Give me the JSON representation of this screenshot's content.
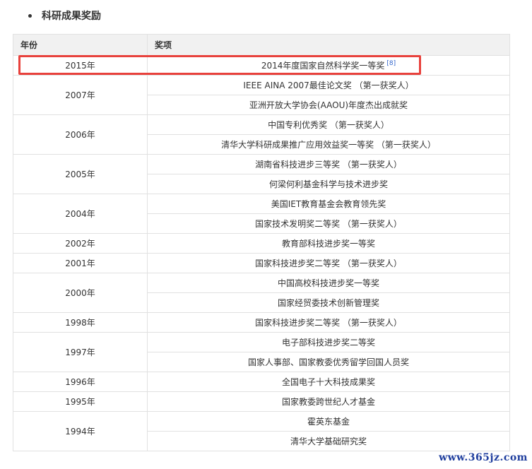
{
  "section": {
    "title": "科研成果奖励"
  },
  "table": {
    "headers": {
      "year": "年份",
      "award": "奖项"
    },
    "groups": [
      {
        "year": "2015年",
        "awards": [
          {
            "text": "2014年度国家自然科学奖一等奖",
            "ref": "[8]"
          }
        ]
      },
      {
        "year": "2007年",
        "awards": [
          {
            "text": "IEEE AINA 2007最佳论文奖 （第一获奖人）"
          },
          {
            "text": "亚洲开放大学协会(AAOU)年度杰出成就奖"
          }
        ]
      },
      {
        "year": "2006年",
        "awards": [
          {
            "text": "中国专利优秀奖 （第一获奖人）"
          },
          {
            "text": "清华大学科研成果推广应用效益奖一等奖 （第一获奖人）"
          }
        ]
      },
      {
        "year": "2005年",
        "awards": [
          {
            "text": "湖南省科技进步三等奖 （第一获奖人）"
          },
          {
            "text": "何梁何利基金科学与技术进步奖"
          }
        ]
      },
      {
        "year": "2004年",
        "awards": [
          {
            "text": "美国IET教育基金会教育领先奖"
          },
          {
            "text": "国家技术发明奖二等奖 （第一获奖人）"
          }
        ]
      },
      {
        "year": "2002年",
        "awards": [
          {
            "text": "教育部科技进步奖一等奖"
          }
        ]
      },
      {
        "year": "2001年",
        "awards": [
          {
            "text": "国家科技进步奖二等奖 （第一获奖人）"
          }
        ]
      },
      {
        "year": "2000年",
        "awards": [
          {
            "text": "中国高校科技进步奖一等奖"
          },
          {
            "text": "国家经贸委技术创新管理奖"
          }
        ]
      },
      {
        "year": "1998年",
        "awards": [
          {
            "text": "国家科技进步奖二等奖 （第一获奖人）"
          }
        ]
      },
      {
        "year": "1997年",
        "awards": [
          {
            "text": "电子部科技进步奖二等奖"
          },
          {
            "text": "国家人事部、国家教委优秀留学回国人员奖"
          }
        ]
      },
      {
        "year": "1996年",
        "awards": [
          {
            "text": "全国电子十大科技成果奖"
          }
        ]
      },
      {
        "year": "1995年",
        "awards": [
          {
            "text": "国家教委跨世纪人才基金"
          }
        ]
      },
      {
        "year": "1994年",
        "awards": [
          {
            "text": "霍英东基金"
          },
          {
            "text": "清华大学基础研究奖"
          }
        ]
      }
    ]
  },
  "watermark": "www.365jz.com",
  "colors": {
    "highlight": "#e8413c",
    "header_bg": "#f1f1f1",
    "border": "#e1e1e1",
    "ref_link": "#3366cc",
    "watermark": "#1f3e9e"
  }
}
